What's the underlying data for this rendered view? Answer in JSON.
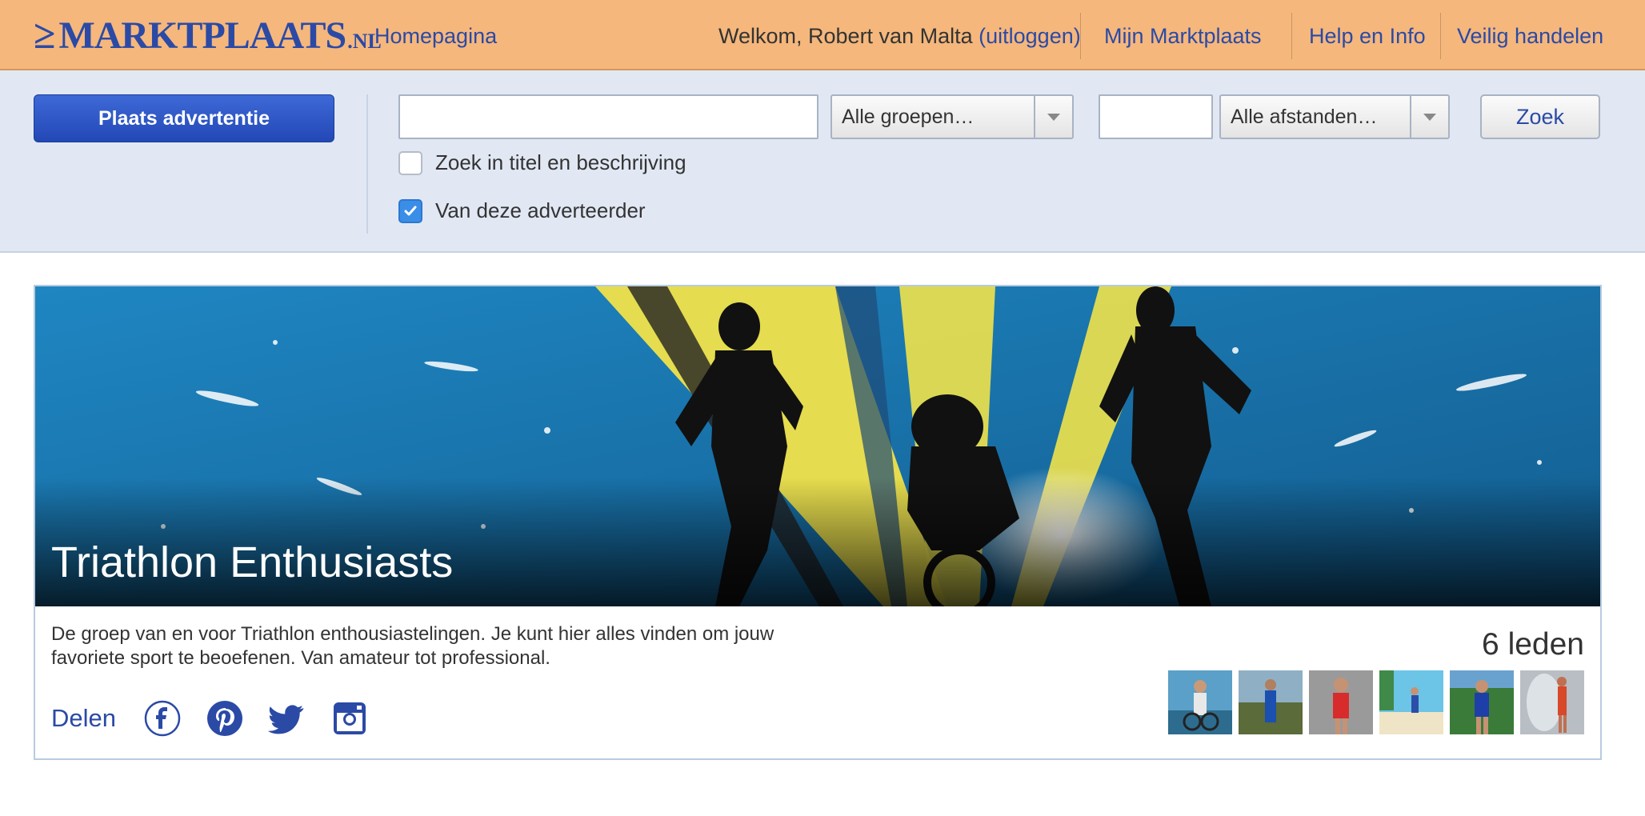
{
  "header": {
    "logo_mark": "≥",
    "logo_word": "MARKTPLAATS",
    "logo_tld": ".NL",
    "home_link": "Homepagina",
    "welcome_prefix": "Welkom, Robert van Malta",
    "logout_link": "(uitloggen)",
    "my_marktplaats": "Mijn Marktplaats",
    "help": "Help en Info",
    "safe_trading": "Veilig handelen"
  },
  "search": {
    "place_ad_label": "Plaats advertentie",
    "query_value": "",
    "group_select": "Alle groepen…",
    "postcode_value": "",
    "distance_select": "Alle afstanden…",
    "search_button": "Zoek",
    "check_title_desc": {
      "label": "Zoek in titel en beschrijving",
      "checked": false
    },
    "check_advertiser": {
      "label": "Van deze adverteerder",
      "checked": true
    }
  },
  "group": {
    "title": "Triathlon Enthusiasts",
    "description": "De groep van en voor Triathlon enthousiastelingen. Je kunt hier alles vinden om jouw favoriete sport te beoefenen. Van amateur tot professional.",
    "share_label": "Delen",
    "social_icons": [
      "facebook-icon",
      "pinterest-icon",
      "twitter-icon",
      "instagram-icon"
    ],
    "members_count": "6 leden",
    "member_avatars": 6
  },
  "colors": {
    "header_bg": "#f5b77c",
    "link": "#2b4aa6",
    "searchbar_bg": "#e1e8f4",
    "primary_button": "#2b50c0",
    "banner_blue": "#1b78b3",
    "banner_yellow": "#f0e24a"
  }
}
